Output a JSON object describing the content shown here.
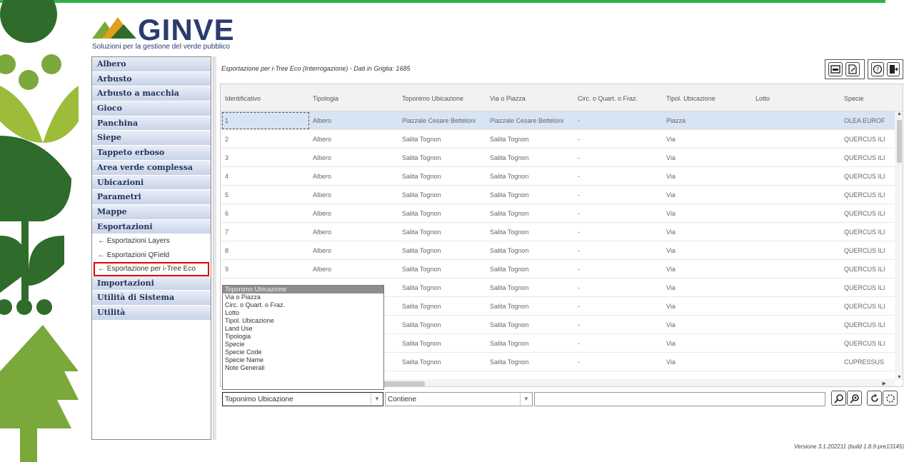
{
  "brand": {
    "name": "GINVE",
    "tagline": "Soluzioni per la gestione del verde pubblico"
  },
  "nav": {
    "sections": [
      "Albero",
      "Arbusto",
      "Arbusto a macchia",
      "Gioco",
      "Panchina",
      "Siepe",
      "Tappeto erboso",
      "Area verde complessa",
      "Ubicazioni",
      "Parametri",
      "Mappe",
      "Esportazioni"
    ],
    "subitems": [
      "← Esportazioni Layers",
      "← Esportazioni QField",
      "← Esportazione per i-Tree Eco"
    ],
    "sections_after": [
      "Importazioni",
      "Utilità di Sistema",
      "Utilità"
    ]
  },
  "header": {
    "title": "Esportazione per i-Tree Eco (Interrogazione) - Dati in Griglia: 1685"
  },
  "table": {
    "columns": [
      "Identificativo",
      "Tipologia",
      "Toponimo Ubicazione",
      "Via o Piazza",
      "Circ. o Quart. o Fraz.",
      "Tipol. Ubicazione",
      "Lotto",
      "Specie"
    ],
    "rows": [
      [
        "1",
        "Albero",
        "Piazzale Cesare Betteloni",
        "Piazzale Cesare Betteloni",
        "-",
        "Piazza",
        "",
        "OLEA EUROF"
      ],
      [
        "2",
        "Albero",
        "Salita Tognon",
        "Salita Tognon",
        "-",
        "Via",
        "",
        "QUERCUS ILI"
      ],
      [
        "3",
        "Albero",
        "Salita Tognon",
        "Salita Tognon",
        "-",
        "Via",
        "",
        "QUERCUS ILI"
      ],
      [
        "4",
        "Albero",
        "Salita Tognon",
        "Salita Tognon",
        "-",
        "Via",
        "",
        "QUERCUS ILI"
      ],
      [
        "5",
        "Albero",
        "Salita Tognon",
        "Salita Tognon",
        "-",
        "Via",
        "",
        "QUERCUS ILI"
      ],
      [
        "6",
        "Albero",
        "Salita Tognon",
        "Salita Tognon",
        "-",
        "Via",
        "",
        "QUERCUS ILI"
      ],
      [
        "7",
        "Albero",
        "Salita Tognon",
        "Salita Tognon",
        "-",
        "Via",
        "",
        "QUERCUS ILI"
      ],
      [
        "8",
        "Albero",
        "Salita Tognon",
        "Salita Tognon",
        "-",
        "Via",
        "",
        "QUERCUS ILI"
      ],
      [
        "9",
        "Albero",
        "Salita Tognon",
        "Salita Tognon",
        "-",
        "Via",
        "",
        "QUERCUS ILI"
      ],
      [
        "",
        "",
        "Salita Tognon",
        "Salita Tognon",
        "-",
        "Via",
        "",
        "QUERCUS ILI"
      ],
      [
        "",
        "",
        "Salita Tognon",
        "Salita Tognon",
        "-",
        "Via",
        "",
        "QUERCUS ILI"
      ],
      [
        "",
        "",
        "Salita Tognon",
        "Salita Tognon",
        "-",
        "Via",
        "",
        "QUERCUS ILI"
      ],
      [
        "",
        "",
        "Salita Tognon",
        "Salita Tognon",
        "-",
        "Via",
        "",
        "QUERCUS ILI"
      ],
      [
        "",
        "",
        "Salita Tognon",
        "Salita Tognon",
        "-",
        "Via",
        "",
        "CUPRESSUS"
      ]
    ]
  },
  "dropdown": {
    "options": [
      "Toponimo Ubicazione",
      "Via o Piazza",
      "Circ. o Quart. o Fraz.",
      "Lotto",
      "Tipol. Ubicazione",
      "Land Use",
      "Tipologia",
      "Specie",
      "Specie Code",
      "Specie Name",
      "Note Generali"
    ]
  },
  "filter": {
    "field": "Toponimo Ubicazione",
    "operator": "Contiene",
    "value": ""
  },
  "version": "Versione 3.1.202211 (build 1.8.9-pre13145)",
  "colors": {
    "accent_green": "#2fb24a",
    "nav_text": "#24345e",
    "selected_row": "#d7e4f4",
    "highlight_red": "#e00000"
  }
}
